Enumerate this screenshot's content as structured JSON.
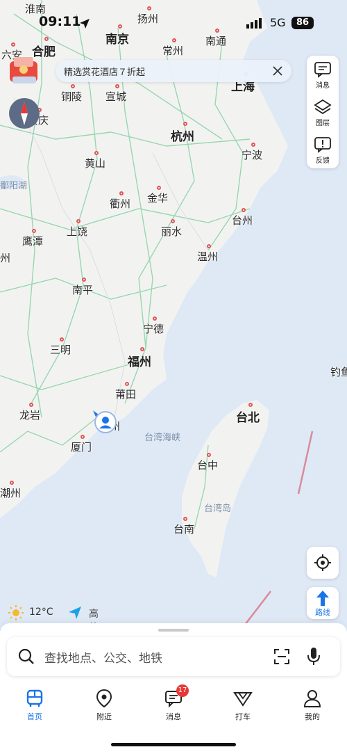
{
  "status_bar": {
    "time": "09:11",
    "network": "5G",
    "battery": "86"
  },
  "banner": {
    "text": "精选赏花酒店７折起"
  },
  "side_panel": [
    {
      "label": "消息",
      "icon": "message-icon"
    },
    {
      "label": "图层",
      "icon": "layers-icon"
    },
    {
      "label": "反馈",
      "icon": "feedback-icon"
    }
  ],
  "map": {
    "cities": [
      {
        "name": "淮南",
        "big": false
      },
      {
        "name": "扬州",
        "big": false
      },
      {
        "name": "南京",
        "big": true
      },
      {
        "name": "常州",
        "big": false
      },
      {
        "name": "南通",
        "big": false
      },
      {
        "name": "六安",
        "big": false
      },
      {
        "name": "合肥",
        "big": true
      },
      {
        "name": "上海",
        "big": true
      },
      {
        "name": "铜陵",
        "big": false
      },
      {
        "name": "宣城",
        "big": false
      },
      {
        "name": "安庆",
        "big": false
      },
      {
        "name": "杭州",
        "big": true
      },
      {
        "name": "宁波",
        "big": false
      },
      {
        "name": "黄山",
        "big": false
      },
      {
        "name": "鄱阳湖",
        "big": false
      },
      {
        "name": "衢州",
        "big": false
      },
      {
        "name": "金华",
        "big": false
      },
      {
        "name": "丽水",
        "big": false
      },
      {
        "name": "台州",
        "big": false
      },
      {
        "name": "鹰潭",
        "big": false
      },
      {
        "name": "上饶",
        "big": false
      },
      {
        "name": "温州",
        "big": false
      },
      {
        "name": "南平",
        "big": false
      },
      {
        "name": "宁德",
        "big": false
      },
      {
        "name": "三明",
        "big": false
      },
      {
        "name": "福州",
        "big": true
      },
      {
        "name": "钓鱼",
        "big": false
      },
      {
        "name": "莆田",
        "big": false
      },
      {
        "name": "龙岩",
        "big": false
      },
      {
        "name": "台北",
        "big": true
      },
      {
        "name": "州",
        "big": false
      },
      {
        "name": "台湾海峡",
        "big": false
      },
      {
        "name": "厦门",
        "big": false
      },
      {
        "name": "台中",
        "big": false
      },
      {
        "name": "潮州",
        "big": false
      },
      {
        "name": "台湾岛",
        "big": false
      },
      {
        "name": "台南",
        "big": false
      },
      {
        "name": "州",
        "big": false
      }
    ]
  },
  "weather": {
    "temperature": "12°C",
    "brand": "高德地图"
  },
  "search": {
    "placeholder": "查找地点、公交、地铁"
  },
  "tabs": [
    {
      "label": "首页",
      "icon": "bus-icon",
      "active": true
    },
    {
      "label": "附近",
      "icon": "location-pin-icon",
      "active": false
    },
    {
      "label": "消息",
      "icon": "chat-icon",
      "active": false,
      "badge": "17"
    },
    {
      "label": "打车",
      "icon": "taxi-icon",
      "active": false
    },
    {
      "label": "我的",
      "icon": "person-icon",
      "active": false
    }
  ],
  "colors": {
    "accent": "#1a73e8",
    "land": "#f2f3f1",
    "sea": "#dfe9f6",
    "road": "#8ed3a8",
    "badge": "#e53935"
  }
}
